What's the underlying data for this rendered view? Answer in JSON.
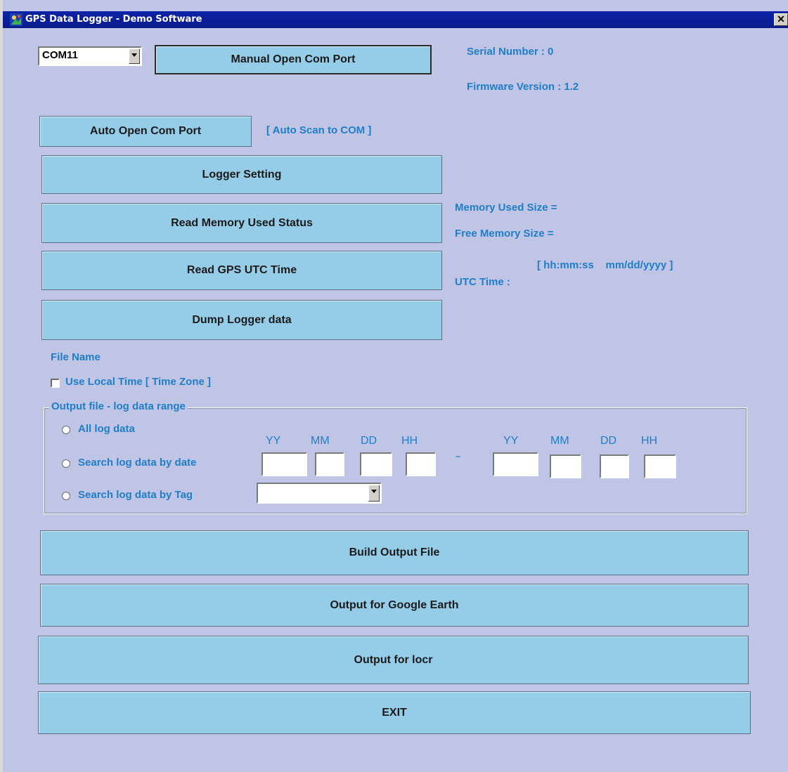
{
  "window": {
    "title": "GPS Data Logger - Demo Software",
    "close_glyph": "✕"
  },
  "com": {
    "port_value": "COM11",
    "manual_open": "Manual Open Com Port",
    "auto_open": "Auto Open Com Port",
    "auto_scan_hint": "[ Auto Scan to COM ]"
  },
  "device": {
    "serial": "Serial Number : 0",
    "firmware": "Firmware Version : 1.2"
  },
  "actions": {
    "logger_setting": "Logger Setting",
    "read_memory": "Read Memory Used Status",
    "read_utc": "Read GPS UTC Time",
    "dump": "Dump Logger data"
  },
  "status": {
    "memory_used": "Memory Used Size =",
    "free_memory": "Free Memory  Size =",
    "utc_format": "[ hh:mm:ss    mm/dd/yyyy ]",
    "utc_time": "UTC Time :"
  },
  "file": {
    "file_name": "File Name",
    "use_local_time": "Use Local Time [ Time Zone ]"
  },
  "range": {
    "legend": "Output file - log data range",
    "all": "All log data",
    "by_date": "Search log data by date",
    "by_tag": "Search log data by Tag",
    "yy": "YY",
    "mm": "MM",
    "dd": "DD",
    "hh": "HH",
    "tilde": "~",
    "tag_value": ""
  },
  "output": {
    "build": "Build Output File",
    "google_earth": "Output for Google Earth",
    "locr": "Output for locr",
    "exit": "EXIT"
  },
  "colors": {
    "window_bg": "#c0c5e6",
    "button_bg": "#95cde9",
    "label_blue": "#1e7ec8",
    "titlebar": "#0a1b8c"
  }
}
